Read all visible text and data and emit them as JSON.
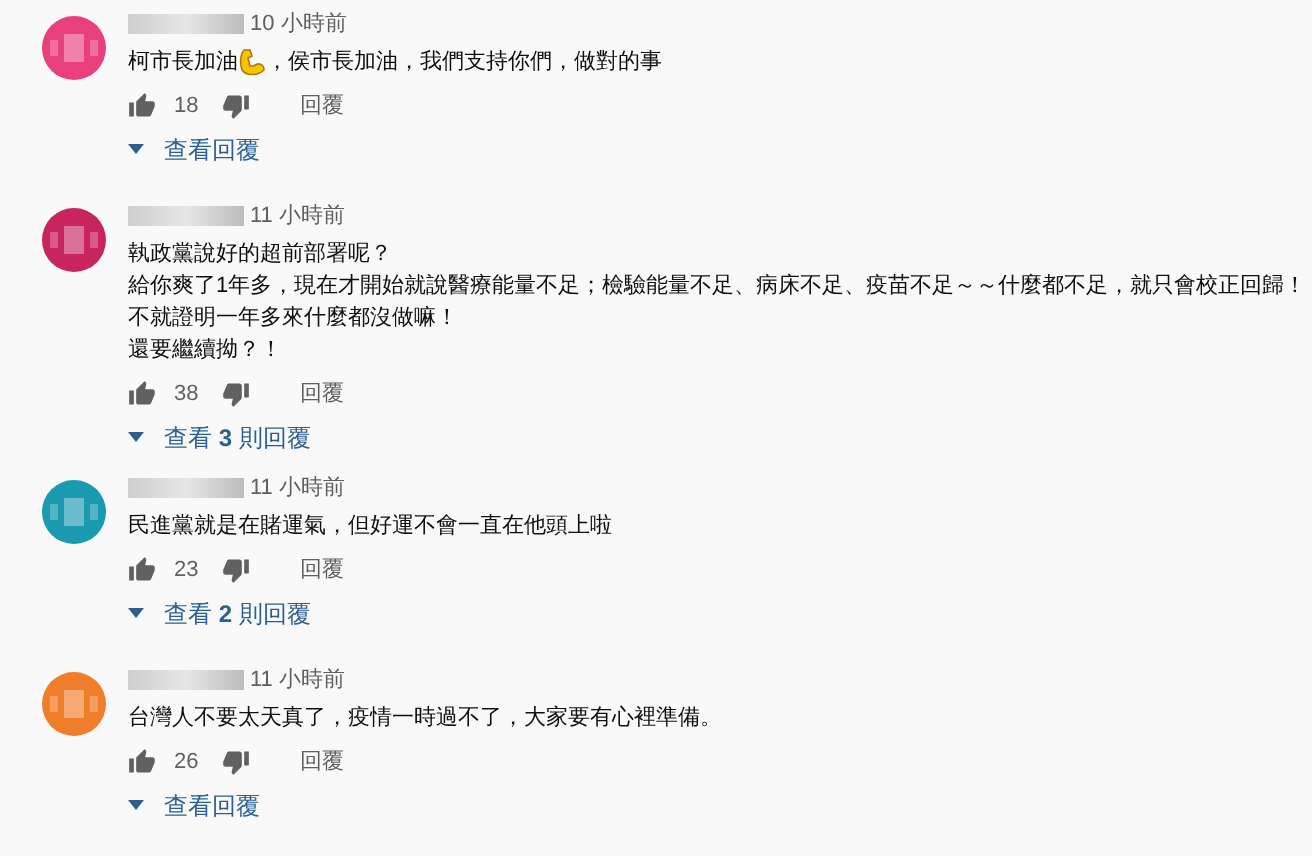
{
  "comments": [
    {
      "color": "#e8407c",
      "time": "10 小時前",
      "body": [
        [
          {
            "kind": "text",
            "text": "柯市長加油"
          },
          {
            "kind": "emoji"
          },
          {
            "kind": "text",
            "text": "，侯市長加油，我們支持你們，做對的事"
          }
        ]
      ],
      "likes": "18",
      "reply": "回覆",
      "replies_link": "查看回覆"
    },
    {
      "color": "#c8245e",
      "time": "11 小時前",
      "body": [
        [
          {
            "kind": "text",
            "text": "執政黨說好的超前部署呢？"
          }
        ],
        [
          {
            "kind": "text",
            "text": "給你爽了1年多，現在才開始就說醫療能量不足；檢驗能量不足、病床不足、疫苗不足～～什麼都不足，就只會校正回歸！"
          }
        ],
        [
          {
            "kind": "text",
            "text": "不就證明一年多來什麼都沒做嘛！"
          }
        ],
        [
          {
            "kind": "text",
            "text": "還要繼續拗？！"
          }
        ]
      ],
      "likes": "38",
      "reply": "回覆",
      "replies_link": "查看 **3** 則回覆"
    },
    {
      "color": "#1a9aae",
      "time": "11 小時前",
      "body": [
        [
          {
            "kind": "text",
            "text": "民進黨就是在賭運氣，但好運不會一直在他頭上啦"
          }
        ]
      ],
      "likes": "23",
      "reply": "回覆",
      "replies_link": "查看 **2** 則回覆"
    },
    {
      "color": "#f07d2a",
      "time": "11 小時前",
      "body": [
        [
          {
            "kind": "text",
            "text": "台灣人不要太天真了，疫情一時過不了，大家要有心裡準備。"
          }
        ]
      ],
      "likes": "26",
      "reply": "回覆",
      "replies_link": "查看回覆"
    }
  ]
}
